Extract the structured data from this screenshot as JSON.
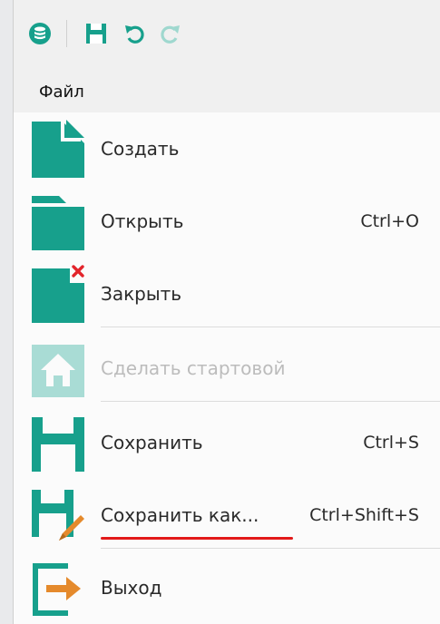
{
  "toolbar": {
    "db_icon": "database-icon",
    "save_icon": "floppy-disk-icon",
    "undo_icon": "undo-icon",
    "redo_icon": "redo-icon"
  },
  "menubar": {
    "title": "Файл"
  },
  "menu": {
    "items": [
      {
        "label": "Создать",
        "shortcut": "",
        "icon": "new-document-icon",
        "enabled": true
      },
      {
        "label": "Открыть",
        "shortcut": "Ctrl+O",
        "icon": "open-folder-icon",
        "enabled": true
      },
      {
        "label": "Закрыть",
        "shortcut": "",
        "icon": "close-document-icon",
        "enabled": true
      },
      {
        "label": "Сделать стартовой",
        "shortcut": "",
        "icon": "home-icon",
        "enabled": false
      },
      {
        "label": "Сохранить",
        "shortcut": "Ctrl+S",
        "icon": "floppy-disk-icon",
        "enabled": true
      },
      {
        "label": "Сохранить как...",
        "shortcut": "Ctrl+Shift+S",
        "icon": "save-as-icon",
        "enabled": true
      },
      {
        "label": "Выход",
        "shortcut": "",
        "icon": "exit-icon",
        "enabled": true
      }
    ]
  },
  "colors": {
    "accent": "#17a08c",
    "accent_disabled": "#a9dcd5",
    "error_mark": "#e3242b",
    "exit_arrow": "#e58a2c",
    "annotation": "#e21a1a"
  }
}
